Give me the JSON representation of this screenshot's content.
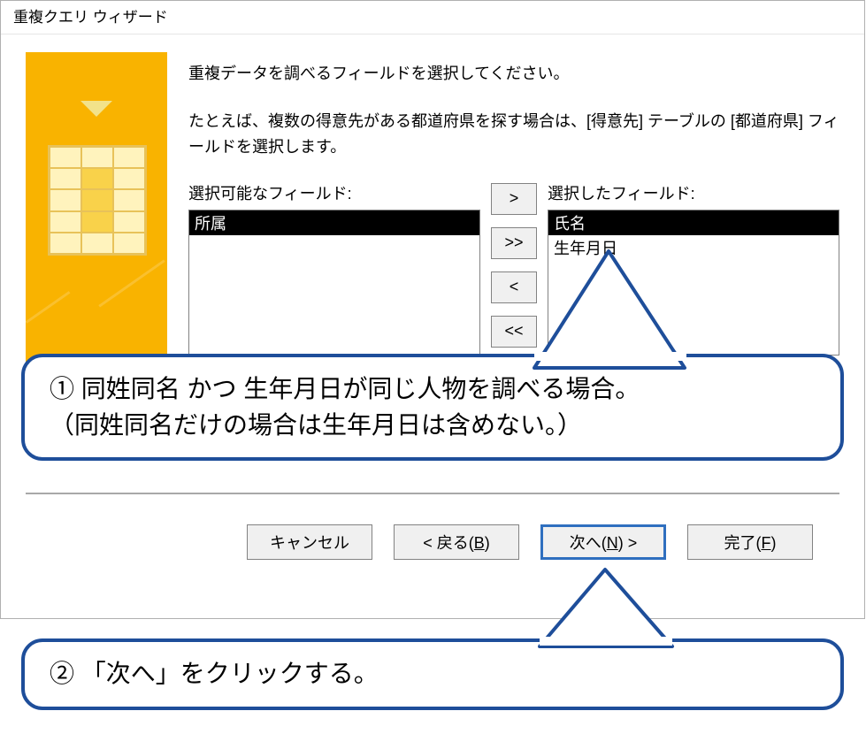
{
  "window": {
    "title": "重複クエリ ウィザード"
  },
  "instructions": {
    "line1": "重複データを調べるフィールドを選択してください。",
    "line2": "たとえば、複数の得意先がある都道府県を探す場合は、[得意先] テーブルの [都道府県] フィールドを選択します。"
  },
  "picker": {
    "available_label": "選択可能なフィールド:",
    "selected_label": "選択したフィールド:",
    "available": [
      {
        "text": "所属",
        "selected": true
      }
    ],
    "selected": [
      {
        "text": "氏名",
        "selected": true
      },
      {
        "text": "生年月日",
        "selected": false
      }
    ],
    "buttons": {
      "add_one": ">",
      "add_all": ">>",
      "remove_one": "<",
      "remove_all": "<<"
    }
  },
  "footer": {
    "cancel": "キャンセル",
    "back_prefix": "< 戻る(",
    "back_key": "B",
    "back_suffix": ")",
    "next_prefix": "次へ(",
    "next_key": "N",
    "next_suffix": ") >",
    "finish_prefix": "完了(",
    "finish_key": "F",
    "finish_suffix": ")"
  },
  "callouts": {
    "c1_line1": "① 同姓同名 かつ 生年月日が同じ人物を調べる場合。",
    "c1_line2": "（同姓同名だけの場合は生年月日は含めない。）",
    "c2": "② 「次へ」をクリックする。"
  }
}
